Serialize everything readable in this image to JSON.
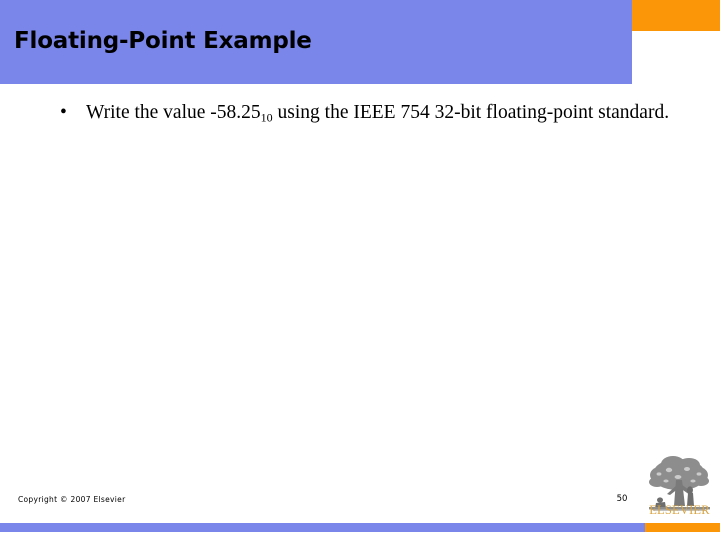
{
  "slide": {
    "title": "Floating-Point Example",
    "page_number": "50",
    "copyright": "Copyright © 2007 Elsevier",
    "colors": {
      "header_blue": "#7b86eb",
      "accent_orange": "#fb9608",
      "background": "#ffffff",
      "title_text": "#000000",
      "body_text": "#000000",
      "logo_gold": "#d9a441"
    }
  },
  "body": {
    "bullets": [
      {
        "marker": "•",
        "text_before_sub": "Write the value -58.25",
        "subscript": "10",
        "text_after_sub": " using the IEEE 754 32-bit floating-point standard."
      }
    ]
  },
  "logo": {
    "name": "elsevier-logo",
    "wordmark": "ELSEVIER"
  }
}
